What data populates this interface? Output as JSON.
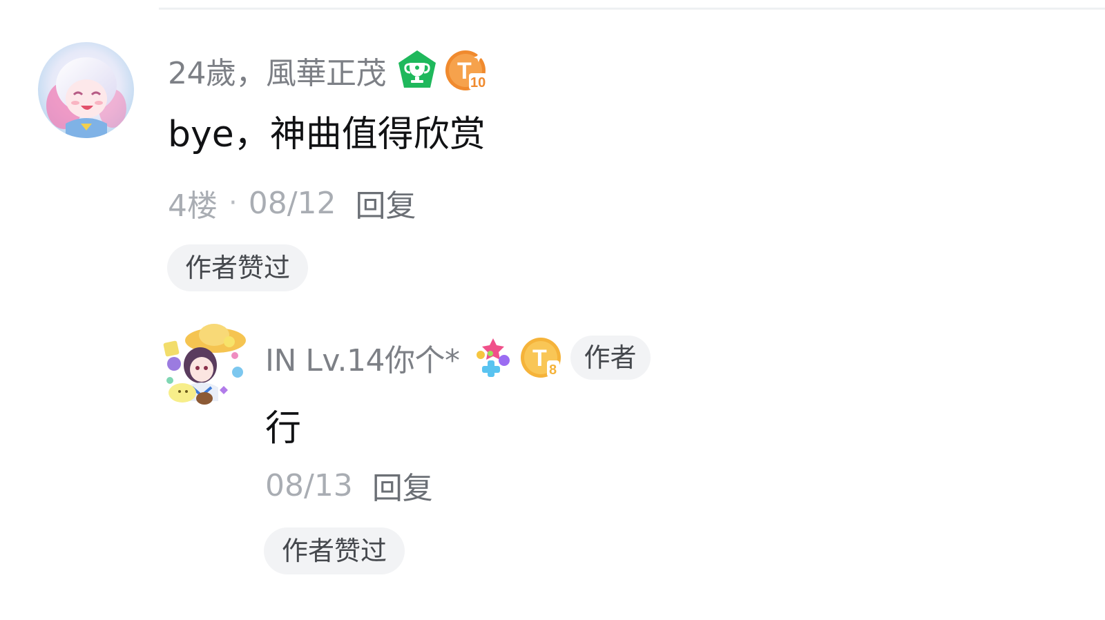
{
  "comment": {
    "username": "24歲，風華正茂",
    "badges": [
      "trophy-badge-icon",
      "top10-fan-badge-icon"
    ],
    "top_badge_label": "T",
    "top_badge_number": "10",
    "text": "bye，神曲值得欣赏",
    "floor": "4楼",
    "separator": "·",
    "date": "08/12",
    "reply_label": "回复",
    "liked_label": "作者赞过"
  },
  "reply": {
    "username": "IN Lv.14你个*",
    "badges": [
      "star-decoration-icon",
      "top8-fan-badge-icon"
    ],
    "top_badge_label": "T",
    "top_badge_number": "8",
    "author_tag": "作者",
    "text": "行",
    "date": "08/13",
    "reply_label": "回复",
    "liked_label": "作者赞过"
  },
  "colors": {
    "trophy_green": "#1fb85c",
    "top_badge_orange": "#f08a2e",
    "top_badge_gold": "#f5b33a",
    "text_primary": "#111214",
    "text_secondary": "#7d8086",
    "text_meta": "#a9adb3",
    "pill_bg": "#f2f3f5"
  }
}
